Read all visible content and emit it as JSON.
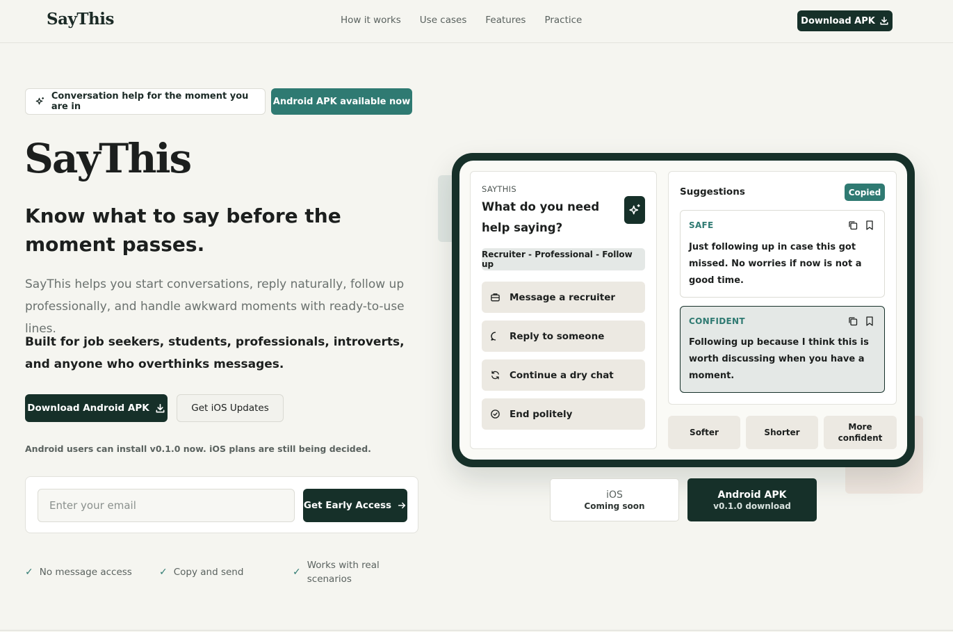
{
  "nav": {
    "logo": "SayThis",
    "links": [
      "How it works",
      "Use cases",
      "Features",
      "Practice"
    ],
    "download_label": "Download APK"
  },
  "hero": {
    "badge_text": "Conversation help for the moment you are in",
    "badge_highlight": "Android APK available now",
    "title": "SayThis",
    "subtitle": "Know what to say before the moment passes.",
    "description": "SayThis helps you start conversations, reply naturally, follow up professionally, and handle awkward moments with ready-to-use lines.",
    "built_for": "Built for job seekers, students, professionals, introverts, and anyone who overthinks messages.",
    "primary_cta": "Download Android APK",
    "secondary_cta": "Get iOS Updates",
    "note": "Android users can install v0.1.0 now. iOS plans are still being decided.",
    "email_placeholder": "Enter your email",
    "email_value": "",
    "early_access": "Get Early Access",
    "checks": [
      "No message access",
      "Copy and send",
      "Works with real scenarios"
    ]
  },
  "mockup": {
    "eyebrow": "SAYTHIS",
    "question": "What do you need help saying?",
    "context_tag": "Recruiter - Professional - Follow up",
    "options": [
      {
        "label": "Message a recruiter",
        "icon": "briefcase-icon"
      },
      {
        "label": "Reply to someone",
        "icon": "chat-bubble-icon"
      },
      {
        "label": "Continue a dry chat",
        "icon": "refresh-icon"
      },
      {
        "label": "End politely",
        "icon": "check-circle-icon"
      }
    ],
    "suggestions_title": "Suggestions",
    "copied_badge": "Copied",
    "suggestions": [
      {
        "label": "SAFE",
        "text": "Just following up in case this got missed. No worries if now is not a good time."
      },
      {
        "label": "CONFIDENT",
        "text": "Following up because I think this is worth discussing when you have a moment."
      }
    ],
    "tones": [
      "Softer",
      "Shorter",
      "More confident"
    ],
    "stores": {
      "ios_name": "iOS",
      "ios_sub": "Coming soon",
      "android_name": "Android APK",
      "android_sub": "v0.1.0 download"
    }
  },
  "colors": {
    "background": "#f5f5f0",
    "primary_dark": "#163029",
    "accent_teal": "#2f7a72"
  }
}
